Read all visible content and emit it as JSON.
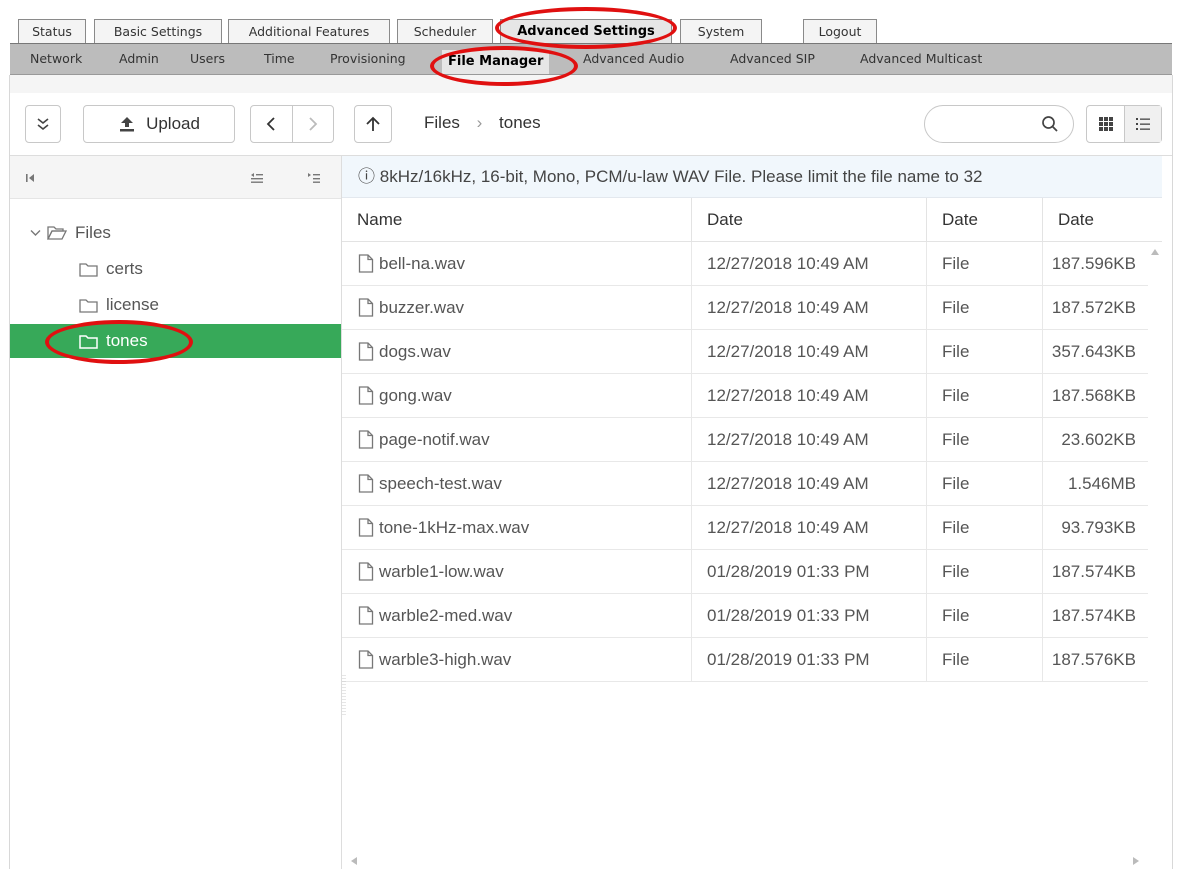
{
  "top_tabs": [
    "Status",
    "Basic Settings",
    "Additional Features",
    "Scheduler",
    "Advanced Settings",
    "System",
    "Logout"
  ],
  "sub_tabs": [
    "Network",
    "Admin",
    "Users",
    "Time",
    "Provisioning",
    "File Manager",
    "Advanced Audio",
    "Advanced SIP",
    "Advanced Multicast"
  ],
  "toolbar": {
    "upload_label": "Upload",
    "breadcrumb": [
      "Files",
      "tones"
    ],
    "search_placeholder": ""
  },
  "tree": {
    "root": "Files",
    "children": [
      "certs",
      "license",
      "tones"
    ],
    "selected": "tones"
  },
  "info_text": "8kHz/16kHz, 16-bit, Mono, PCM/u-law WAV File. Please limit the file name to 32",
  "columns": [
    "Name",
    "Date",
    "Date",
    "Date"
  ],
  "files": [
    {
      "name": "bell-na.wav",
      "date": "12/27/2018 10:49 AM",
      "type": "File",
      "size": "187.596KB"
    },
    {
      "name": "buzzer.wav",
      "date": "12/27/2018 10:49 AM",
      "type": "File",
      "size": "187.572KB"
    },
    {
      "name": "dogs.wav",
      "date": "12/27/2018 10:49 AM",
      "type": "File",
      "size": "357.643KB"
    },
    {
      "name": "gong.wav",
      "date": "12/27/2018 10:49 AM",
      "type": "File",
      "size": "187.568KB"
    },
    {
      "name": "page-notif.wav",
      "date": "12/27/2018 10:49 AM",
      "type": "File",
      "size": "23.602KB"
    },
    {
      "name": "speech-test.wav",
      "date": "12/27/2018 10:49 AM",
      "type": "File",
      "size": "1.546MB"
    },
    {
      "name": "tone-1kHz-max.wav",
      "date": "12/27/2018 10:49 AM",
      "type": "File",
      "size": "93.793KB"
    },
    {
      "name": "warble1-low.wav",
      "date": "01/28/2019 01:33 PM",
      "type": "File",
      "size": "187.574KB"
    },
    {
      "name": "warble2-med.wav",
      "date": "01/28/2019 01:33 PM",
      "type": "File",
      "size": "187.574KB"
    },
    {
      "name": "warble3-high.wav",
      "date": "01/28/2019 01:33 PM",
      "type": "File",
      "size": "187.576KB"
    }
  ],
  "colors": {
    "selected_green": "#37a959",
    "annotation_red": "#e01010",
    "info_bg": "#f1f7fc",
    "subtab_bar": "#bcbcbc"
  }
}
